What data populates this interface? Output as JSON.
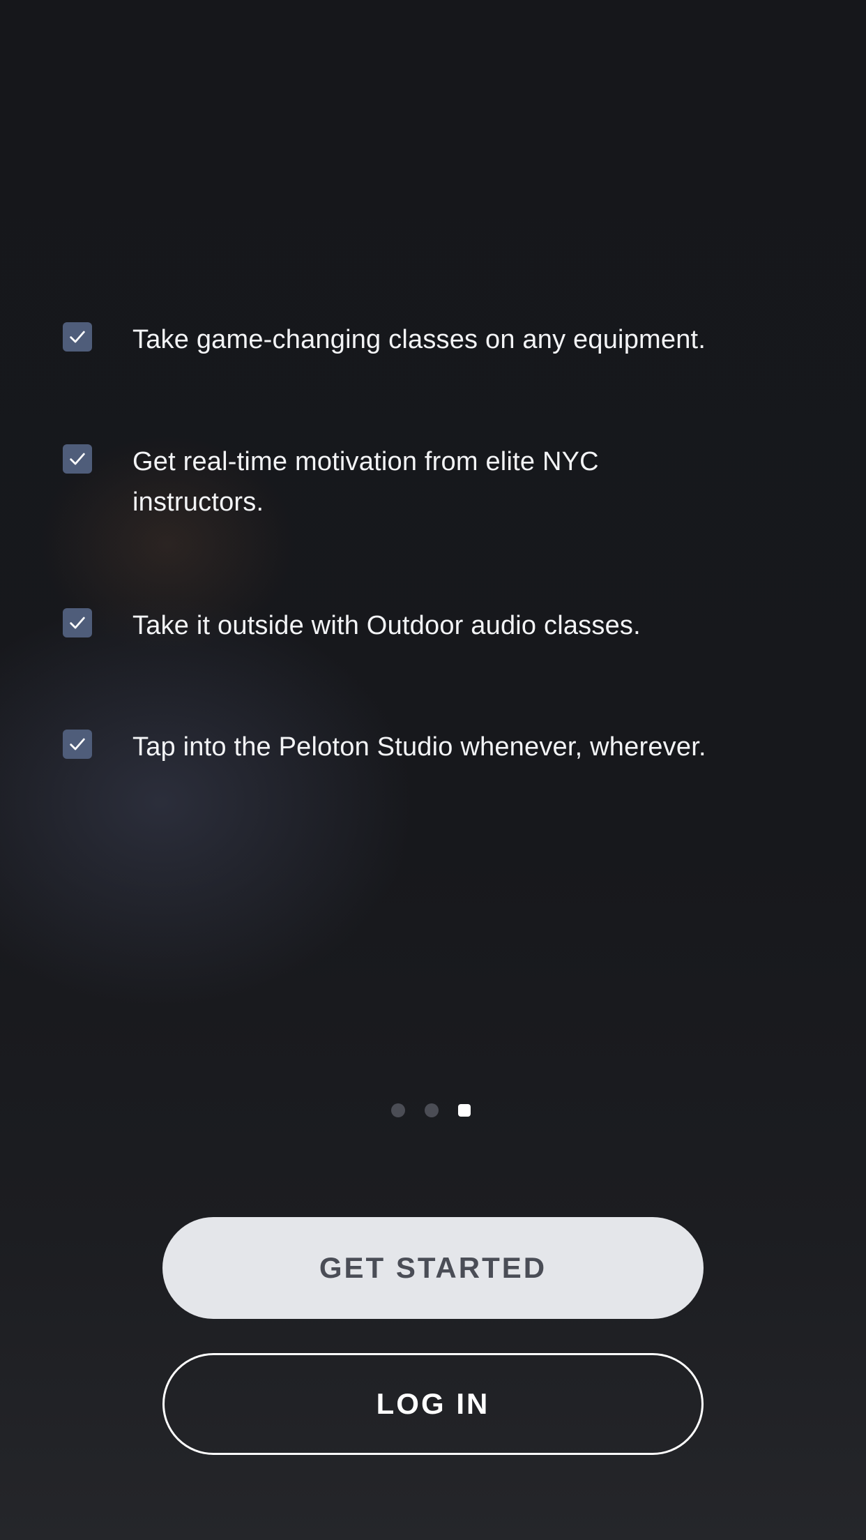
{
  "features": [
    {
      "text": "Take game-changing classes on any equipment."
    },
    {
      "text": "Get real-time motivation from elite NYC instructors."
    },
    {
      "text": "Take it outside with Outdoor audio classes."
    },
    {
      "text": "Tap into the Peloton Studio whenever, wherever."
    }
  ],
  "page_indicator": {
    "total": 3,
    "active": 3
  },
  "buttons": {
    "get_started": "GET STARTED",
    "log_in": "LOG IN"
  },
  "colors": {
    "background": "#16171b",
    "check_fill": "#4f5d7a",
    "primary_button": "#e4e6ea",
    "primary_button_text": "#4a4d56"
  }
}
